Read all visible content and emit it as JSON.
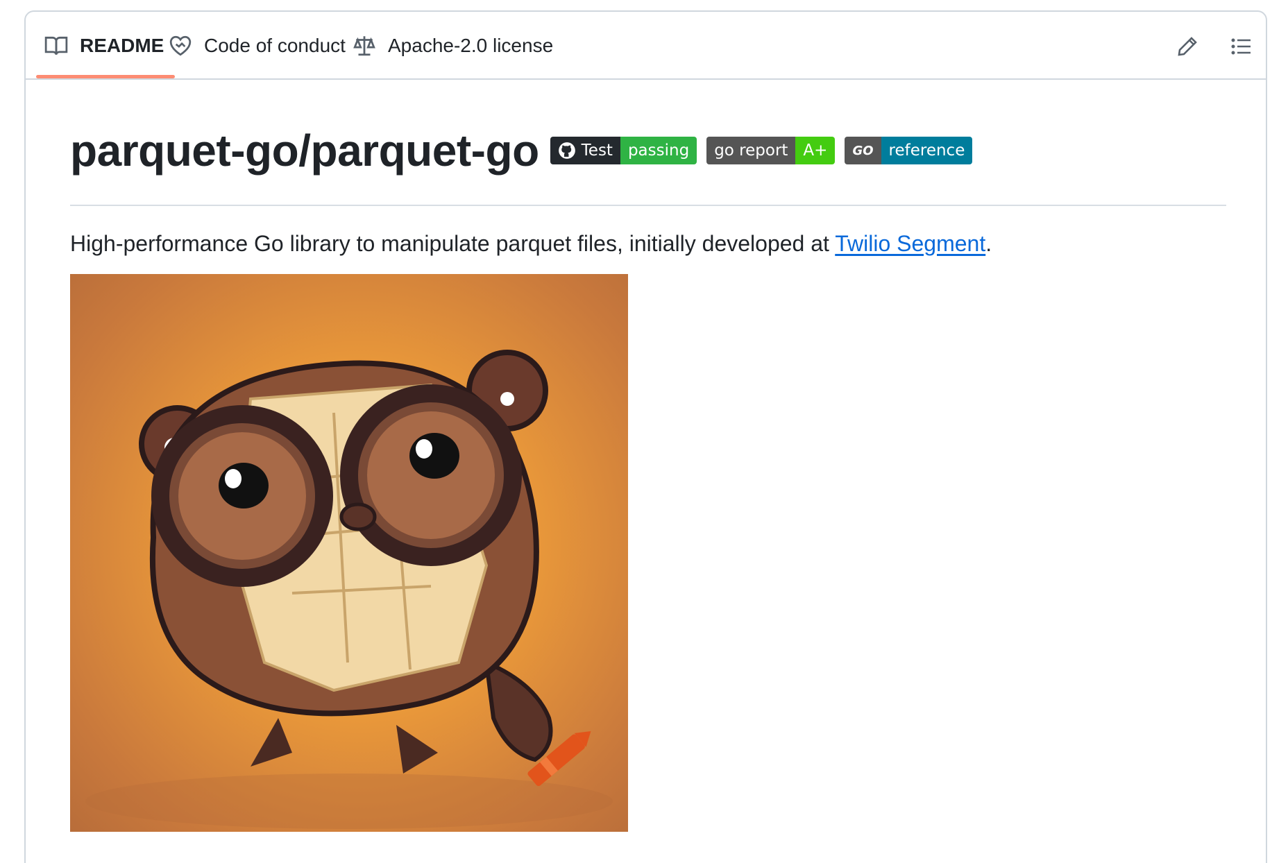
{
  "tabs": [
    {
      "label": "README",
      "icon": "book-icon",
      "active": true
    },
    {
      "label": "Code of conduct",
      "icon": "heart-handshake-icon",
      "active": false
    },
    {
      "label": "Apache-2.0 license",
      "icon": "scale-icon",
      "active": false
    }
  ],
  "toolbar": {
    "edit_icon": "pencil-icon",
    "outline_icon": "list-icon"
  },
  "readme": {
    "title": "parquet-go/parquet-go",
    "badges": [
      {
        "left": "Test",
        "right": "passing",
        "right_color": "#2fb344",
        "icon": "github-icon"
      },
      {
        "left": "go report",
        "right": "A+",
        "right_color": "#44cc11"
      },
      {
        "left": "GO",
        "right": "reference",
        "right_color": "#007d9c",
        "icon": "go-logo-icon"
      }
    ],
    "description_before": "High-performance Go library to manipulate parquet files, initially developed at ",
    "description_link": "Twilio Segment",
    "description_after": ".",
    "image_alt": "gopher mascot holding parquet"
  },
  "colors": {
    "accent_underline": "#fd8c73",
    "link": "#0969da",
    "border": "#d0d7de"
  }
}
